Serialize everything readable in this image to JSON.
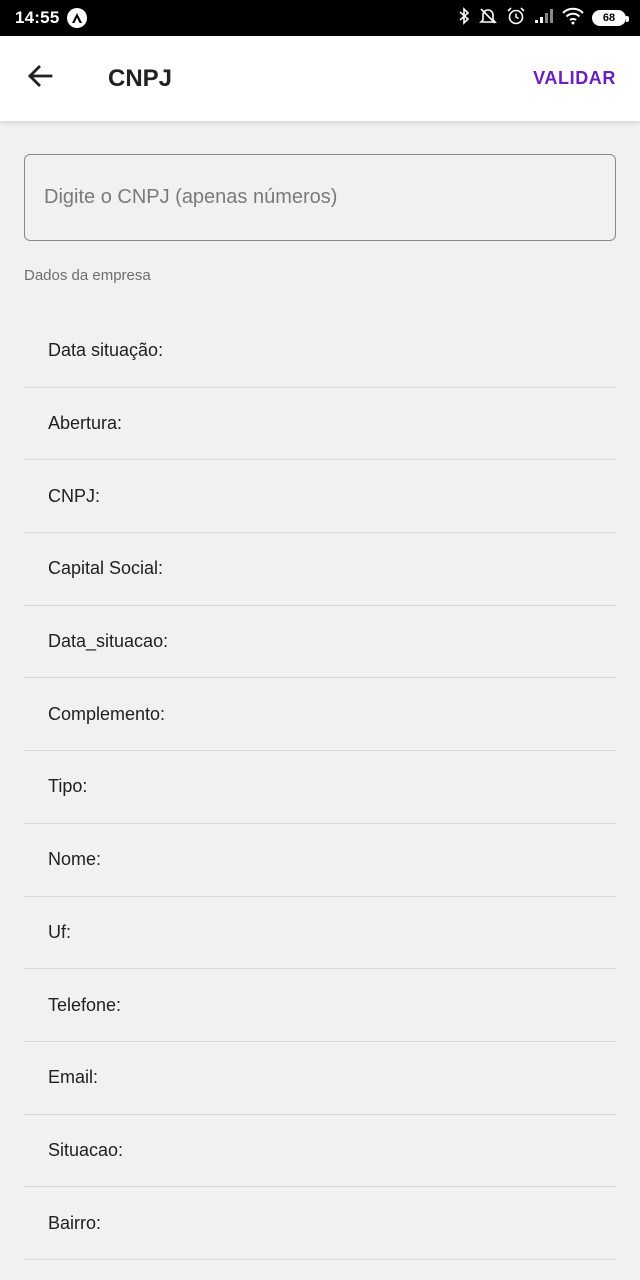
{
  "status_bar": {
    "time": "14:55",
    "battery": "68",
    "icons": [
      "app-notification-icon",
      "bluetooth-icon",
      "do-not-disturb-icon",
      "alarm-icon",
      "signal-icon",
      "wifi-icon",
      "battery-icon"
    ]
  },
  "app_bar": {
    "title": "CNPJ",
    "action_label": "VALIDAR",
    "back_icon": "arrow-back-icon"
  },
  "search": {
    "placeholder": "Digite o CNPJ (apenas números)",
    "value": ""
  },
  "section": {
    "title": "Dados da empresa"
  },
  "fields": [
    {
      "label": "Data situação:"
    },
    {
      "label": "Abertura:"
    },
    {
      "label": "CNPJ:"
    },
    {
      "label": "Capital Social:"
    },
    {
      "label": "Data_situacao:"
    },
    {
      "label": "Complemento:"
    },
    {
      "label": "Tipo:"
    },
    {
      "label": "Nome:"
    },
    {
      "label": "Uf:"
    },
    {
      "label": "Telefone:"
    },
    {
      "label": "Email:"
    },
    {
      "label": "Situacao:"
    },
    {
      "label": "Bairro:"
    }
  ],
  "colors": {
    "accent": "#6a1fc0",
    "background": "#f1f1f1",
    "app_bar": "#ffffff",
    "status_bar": "#000000"
  }
}
